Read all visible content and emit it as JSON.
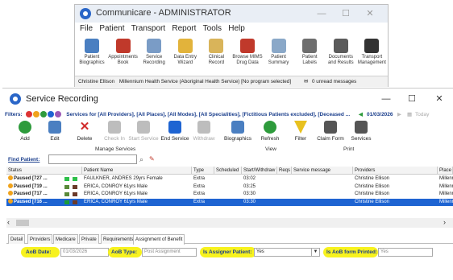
{
  "communicare": {
    "title": "Communicare - ADMINISTRATOR",
    "menu": [
      "File",
      "Patient",
      "Transport",
      "Report",
      "Tools",
      "Help"
    ],
    "toolbar": [
      {
        "label": "Patient Biographics",
        "icon": "patient-biographics-icon",
        "color": "#4a7fc1"
      },
      {
        "label": "Appointments Book",
        "icon": "calendar-icon",
        "color": "#c0392b"
      },
      {
        "label": "Service Recording",
        "icon": "service-recording-icon",
        "color": "#7a9cc6"
      },
      {
        "label": "Data Entry Wizard",
        "icon": "wand-icon",
        "color": "#e2b33b"
      },
      {
        "label": "Clinical Record",
        "icon": "clinical-record-icon",
        "color": "#d9b45a"
      },
      {
        "label": "Browse MIMS Drug Data",
        "icon": "pill-icon",
        "color": "#c0392b"
      },
      {
        "label": "Patient Summary",
        "icon": "clipboard-icon",
        "color": "#8aa8c8"
      },
      {
        "label": "Patient Labels",
        "icon": "labels-icon",
        "color": "#6e6e6e"
      },
      {
        "label": "Documents and Results",
        "icon": "documents-icon",
        "color": "#5b5b5b"
      },
      {
        "label": "Transport Management",
        "icon": "car-icon",
        "color": "#333333"
      }
    ],
    "status_user": "Christine Ellison",
    "status_service": "Millennium Health Service (Aboriginal Health Service) [No program selected]",
    "status_unread": "0 unread messages"
  },
  "service_recording": {
    "title": "Service Recording",
    "filter_label": "Filters:",
    "filter_text": "Services for [All Providers], [All Places], [All Modes], [All Specialities], [Fictitious Patients excluded], [Deceased ...",
    "filter_date": "01/03/2026",
    "filter_today": "Today",
    "toolbar": [
      {
        "label": "Add",
        "enabled": true,
        "color": "#2e9b3c"
      },
      {
        "label": "Edit",
        "enabled": true,
        "color": "#4a7fc1"
      },
      {
        "label": "Delete",
        "enabled": true,
        "color": "#d12c2c"
      },
      {
        "label": "Check In",
        "enabled": false,
        "color": "#bdbdbd"
      },
      {
        "label": "Start Service",
        "enabled": false,
        "color": "#bdbdbd"
      },
      {
        "label": "End Service",
        "enabled": true,
        "color": "#1e64d2"
      },
      {
        "label": "Withdraw",
        "enabled": false,
        "color": "#bdbdbd"
      },
      {
        "label": "Biographics",
        "enabled": true,
        "color": "#4a7fc1"
      },
      {
        "label": "Refresh",
        "enabled": true,
        "color": "#2e9b3c"
      },
      {
        "label": "Filter",
        "enabled": true,
        "color": "#e8c11f"
      },
      {
        "label": "Claim Form",
        "enabled": true,
        "color": "#555555"
      },
      {
        "label": "Services",
        "enabled": true,
        "color": "#555555"
      }
    ],
    "groups": {
      "manage": "Manage Services",
      "view": "View",
      "print": "Print"
    },
    "find_label": "Find Patient:",
    "find_value": "",
    "columns": [
      "Status",
      "Patient Name",
      "Type",
      "Scheduled",
      "Start/Withdraw",
      "Reqs",
      "Service message",
      "Providers",
      "Place at"
    ],
    "rows": [
      {
        "status": "Paused [727 ...",
        "name": "FAULKNER, ANDRES 29yrs Female",
        "type": "Extra",
        "scheduled": "",
        "start": "03:02",
        "reqs": "",
        "message": "",
        "provider": "Christine Ellison",
        "place": "Millenni"
      },
      {
        "status": "Paused [719 ...",
        "name": "ERICA, CONROY 61yrs Male",
        "type": "Extra",
        "scheduled": "",
        "start": "03:25",
        "reqs": "",
        "message": "",
        "provider": "Christine Ellison",
        "place": "Millenni"
      },
      {
        "status": "Paused [717 ...",
        "name": "ERICA, CONROY 61yrs Male",
        "type": "Extra",
        "scheduled": "",
        "start": "03:30",
        "reqs": "",
        "message": "",
        "provider": "Christine Ellison",
        "place": "Millenni"
      },
      {
        "status": "Paused [716 ...",
        "name": "ERICA, CONROY 61yrs Male",
        "type": "Extra",
        "scheduled": "",
        "start": "03:30",
        "reqs": "",
        "message": "",
        "provider": "Christine Ellison",
        "place": "Millenni"
      }
    ],
    "selected_row": 3,
    "tabs": [
      "Detail",
      "Providers",
      "Medicare",
      "Private",
      "Requirements",
      "Assignment of Benefit"
    ],
    "active_tab": 5,
    "aob": {
      "date_label": "AoB Date:",
      "date_value": "01/03/2026",
      "type_label": "AoB Type:",
      "type_value": "Post Assignment",
      "assigner_label": "Is Assigner Patient:",
      "assigner_value": "Yes",
      "printed_label": "Is AoB form Printed:",
      "printed_value": "Yes"
    },
    "highlight_color": "#f7f21e"
  }
}
